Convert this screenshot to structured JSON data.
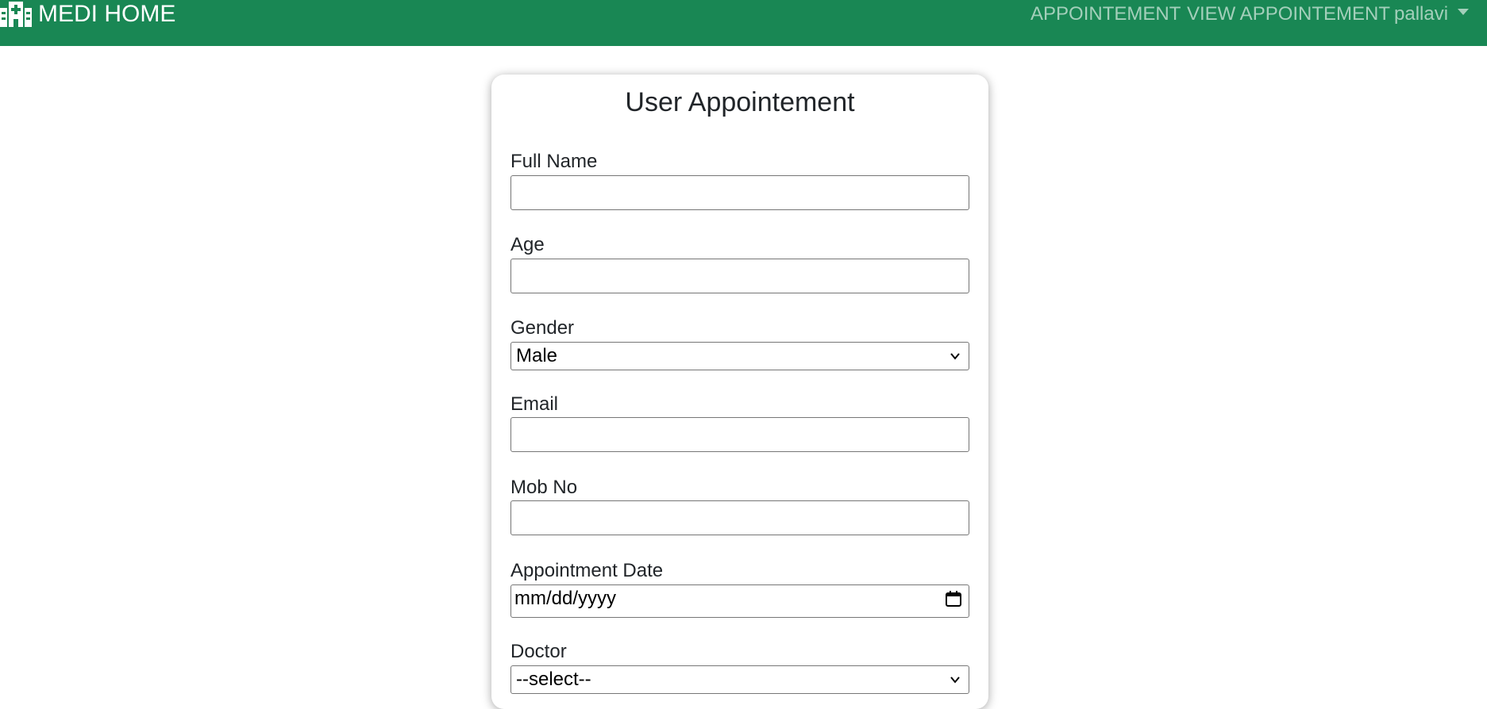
{
  "navbar": {
    "brand": "MEDI HOME",
    "brand_icon": "hospital-icon",
    "links": [
      {
        "label": "APPOINTEMENT"
      },
      {
        "label": "VIEW APPOINTEMENT"
      }
    ],
    "user_menu": {
      "label": "pallavi",
      "icon": "caret-down-icon"
    },
    "background_color": "#198754"
  },
  "form": {
    "title": "User Appointement",
    "fields": {
      "full_name": {
        "label": "Full Name",
        "value": ""
      },
      "age": {
        "label": "Age",
        "value": ""
      },
      "gender": {
        "label": "Gender",
        "selected": "Male"
      },
      "email": {
        "label": "Email",
        "value": ""
      },
      "mobile": {
        "label": "Mob No",
        "value": ""
      },
      "appointment_date": {
        "label": "Appointment Date",
        "placeholder": "mm/dd/yyyy",
        "icon": "calendar-icon"
      },
      "doctor": {
        "label": "Doctor",
        "selected": "--select--"
      }
    }
  }
}
